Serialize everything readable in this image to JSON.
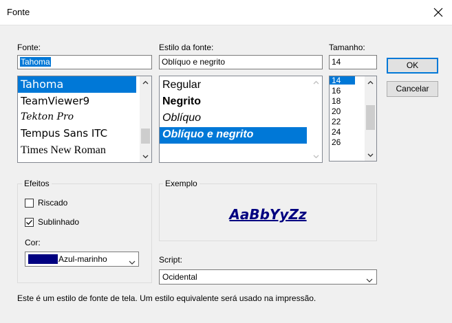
{
  "window": {
    "title": "Fonte",
    "close_glyph": "✕"
  },
  "font": {
    "label": "Fonte:",
    "value": "Tahoma",
    "items": [
      "Tahoma",
      "TeamViewer9",
      "Tekton Pro",
      "Tempus Sans ITC",
      "Times New Roman"
    ],
    "selected_index": 0
  },
  "style": {
    "label": "Estilo da fonte:",
    "value": "Oblíquo e negrito",
    "items": [
      "Regular",
      "Negrito",
      "Oblíquo",
      "Oblíquo e negrito"
    ],
    "selected_index": 3
  },
  "size": {
    "label": "Tamanho:",
    "value": "14",
    "items": [
      "14",
      "16",
      "18",
      "20",
      "22",
      "24",
      "26"
    ],
    "selected_index": 0
  },
  "buttons": {
    "ok": "OK",
    "cancel": "Cancelar"
  },
  "effects": {
    "label": "Efeitos",
    "strikeout": {
      "label": "Riscado",
      "checked": false
    },
    "underline": {
      "label": "Sublinhado",
      "checked": true
    },
    "color_label": "Cor:",
    "color_value": "Azul-marinho",
    "color_hex": "#000080"
  },
  "sample": {
    "label": "Exemplo",
    "text": "AaBbYyZz"
  },
  "script": {
    "label": "Script:",
    "value": "Ocidental"
  },
  "footer": "Este é um estilo de fonte de tela. Um estilo equivalente será usado na impressão.",
  "colors": {
    "selection": "#0078d7",
    "accent": "#0078d7"
  }
}
